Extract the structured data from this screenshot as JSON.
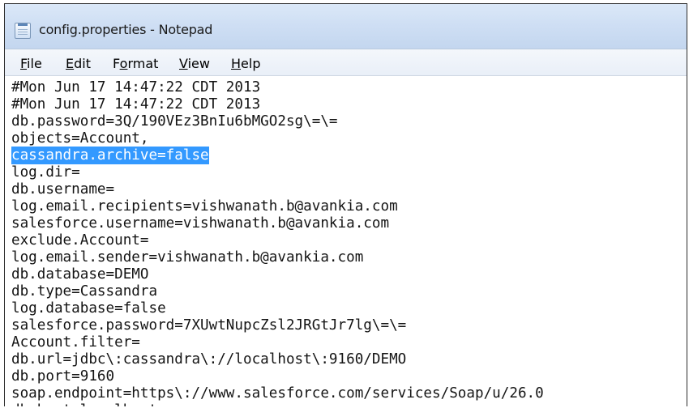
{
  "window": {
    "title": "config.properties - Notepad"
  },
  "menu": {
    "items": [
      {
        "pre": "",
        "key": "F",
        "post": "ile"
      },
      {
        "pre": "",
        "key": "E",
        "post": "dit"
      },
      {
        "pre": "F",
        "key": "o",
        "post": "rmat"
      },
      {
        "pre": "",
        "key": "V",
        "post": "iew"
      },
      {
        "pre": "",
        "key": "H",
        "post": "elp"
      }
    ]
  },
  "editor": {
    "selected_line_index": 4,
    "lines": [
      "#Mon Jun 17 14:47:22 CDT 2013",
      "#Mon Jun 17 14:47:22 CDT 2013",
      "db.password=3Q/190VEz3BnIu6bMGO2sg\\=\\=",
      "objects=Account,",
      "cassandra.archive=false",
      "log.dir=",
      "db.username=",
      "log.email.recipients=vishwanath.b@avankia.com",
      "salesforce.username=vishwanath.b@avankia.com",
      "exclude.Account=",
      "log.email.sender=vishwanath.b@avankia.com",
      "db.database=DEMO",
      "db.type=Cassandra",
      "log.database=false",
      "salesforce.password=7XUwtNupcZsl2JRGtJr7lg\\=\\=",
      "Account.filter=",
      "db.url=jdbc\\:cassandra\\://localhost\\:9160/DEMO",
      "db.port=9160",
      "soap.endpoint=https\\://www.salesforce.com/services/Soap/u/26.0",
      "db.host=localhost"
    ]
  }
}
